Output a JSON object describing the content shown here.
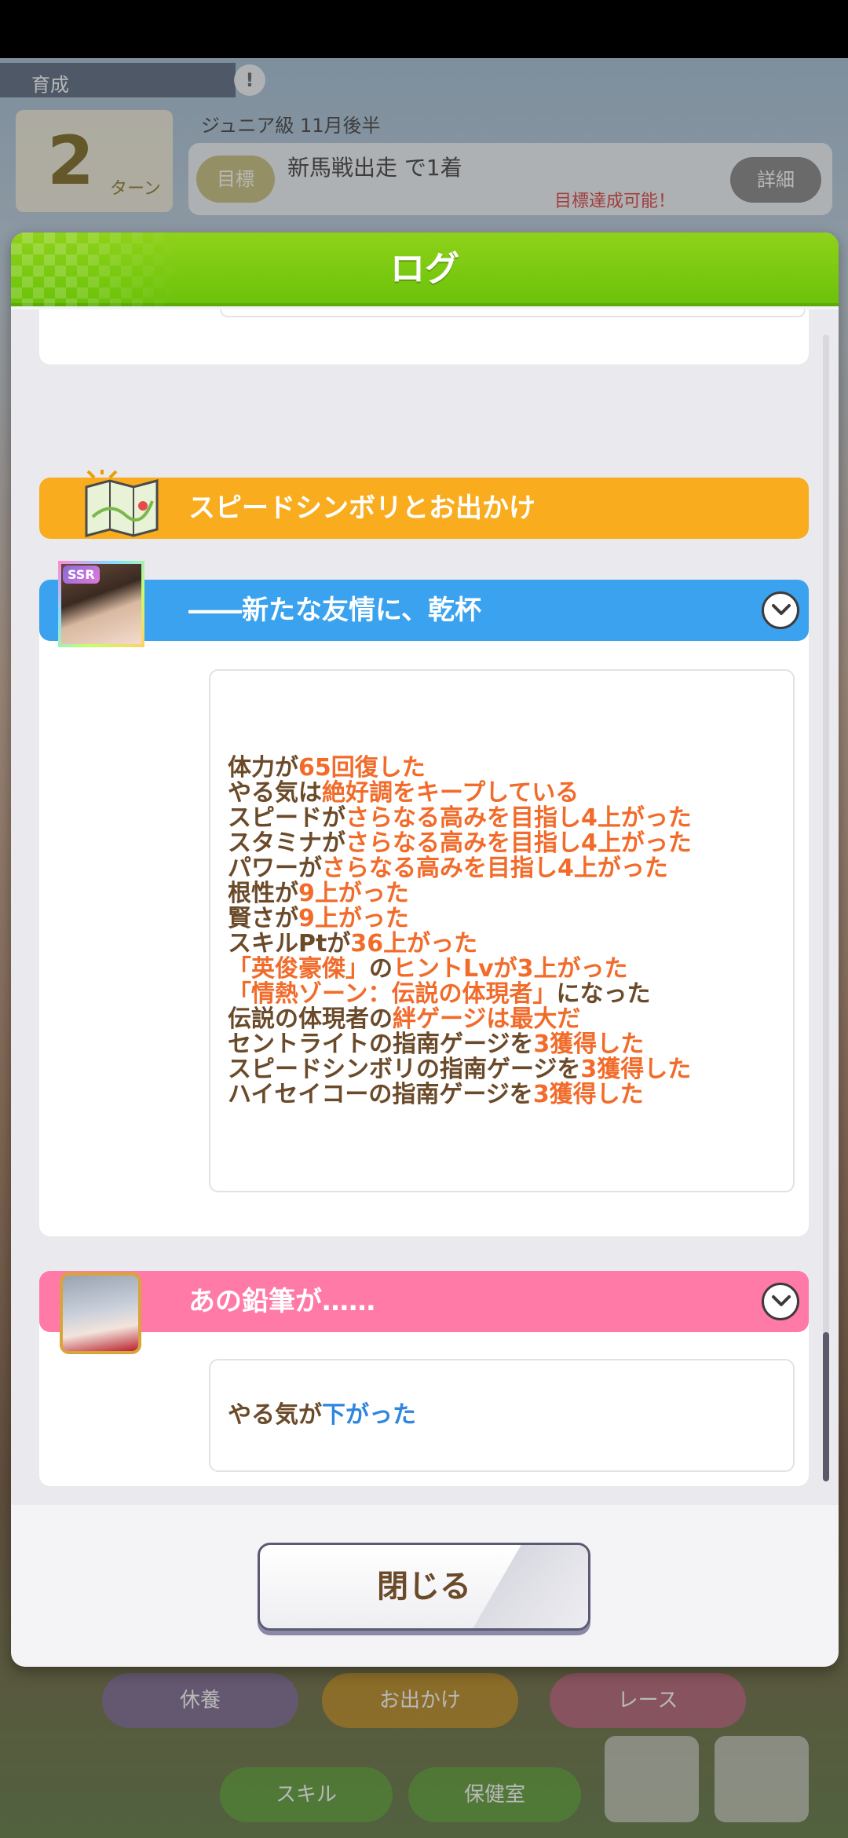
{
  "background": {
    "top_tab": "育成",
    "turn_number": "2",
    "turn_unit": "ターン",
    "subtitle": "ジュニア級 11月後半",
    "goal_tag": "目標",
    "goal_text": "新馬戦出走 で1着",
    "goal_note": "目標達成可能！",
    "goal_button": "詳細",
    "bottom_buttons": [
      "休養",
      "お出かけ",
      "レース",
      "スキル",
      "保健室"
    ]
  },
  "modal": {
    "title": "ログ",
    "close_label": "閉じる"
  },
  "events": [
    {
      "title": "スピードシンボリとお出かけ",
      "color": "#f8ac1e"
    },
    {
      "title": "――新たな友情に、乾杯",
      "color": "#3aa2ee",
      "badge": "SSR",
      "lines": [
        [
          {
            "t": "体力が"
          },
          {
            "t": "65回復した",
            "c": "hl"
          }
        ],
        [
          {
            "t": "やる気は"
          },
          {
            "t": "絶好調をキープしている",
            "c": "hl"
          }
        ],
        [
          {
            "t": "スピードが"
          },
          {
            "t": "さらなる高みを目指し4上がった",
            "c": "hl"
          }
        ],
        [
          {
            "t": "スタミナが"
          },
          {
            "t": "さらなる高みを目指し4上がった",
            "c": "hl"
          }
        ],
        [
          {
            "t": "パワーが"
          },
          {
            "t": "さらなる高みを目指し4上がった",
            "c": "hl"
          }
        ],
        [
          {
            "t": "根性が"
          },
          {
            "t": "9上がった",
            "c": "hl"
          }
        ],
        [
          {
            "t": "賢さが"
          },
          {
            "t": "9上がった",
            "c": "hl"
          }
        ],
        [
          {
            "t": "スキルPtが"
          },
          {
            "t": "36上がった",
            "c": "hl"
          }
        ],
        [
          {
            "t": "「英俊豪傑」",
            "c": "hl"
          },
          {
            "t": "の"
          },
          {
            "t": "ヒントLvが3上がった",
            "c": "hl"
          }
        ],
        [
          {
            "t": "「情熱ゾーン：伝説の体現者」",
            "c": "hl"
          },
          {
            "t": "になった"
          }
        ],
        [
          {
            "t": "伝説の体現者の"
          },
          {
            "t": "絆ゲージは最大だ",
            "c": "hl"
          }
        ],
        [
          {
            "t": "セントライトの指南ゲージを"
          },
          {
            "t": "3獲得した",
            "c": "hl"
          }
        ],
        [
          {
            "t": "スピードシンボリの指南ゲージを"
          },
          {
            "t": "3獲得した",
            "c": "hl"
          }
        ],
        [
          {
            "t": "ハイセイコーの指南ゲージを"
          },
          {
            "t": "3獲得した",
            "c": "hl"
          }
        ]
      ]
    },
    {
      "title": "あの鉛筆が……",
      "color": "#ff7aa6",
      "lines": [
        [
          {
            "t": "やる気が"
          },
          {
            "t": "下がった",
            "c": "hl-blue"
          }
        ]
      ]
    }
  ]
}
